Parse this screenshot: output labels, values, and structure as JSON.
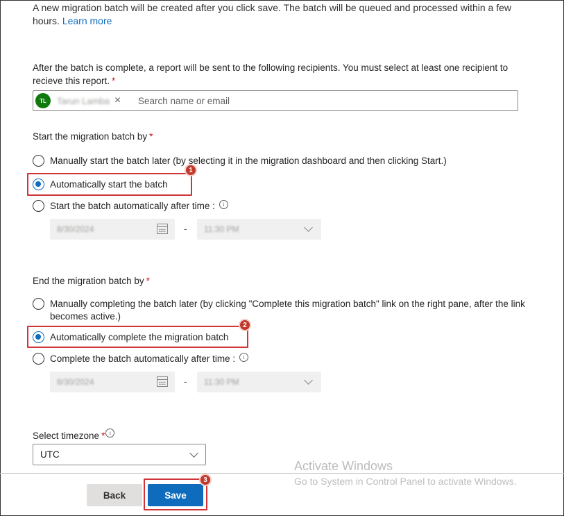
{
  "intro": {
    "text": "A new migration batch will be created after you click save. The batch will be queued and processed within a few hours.",
    "link": "Learn more"
  },
  "recipients": {
    "label": "After the batch is complete, a report will be sent to the following recipients. You must select at least one recipient to recieve this report.",
    "required_mark": "*",
    "chip_initials": "TL",
    "chip_name": "Tarun Lamba",
    "chip_remove": "×",
    "placeholder": "Search name or email"
  },
  "start": {
    "label": "Start the migration batch by",
    "required_mark": "*",
    "options": [
      "Manually start the batch later (by selecting it in the migration dashboard and then clicking Start.)",
      "Automatically start the batch",
      "Start the batch automatically after time :"
    ],
    "selected_index": 1,
    "date": "8/30/2024",
    "time": "11:30 PM",
    "separator": "-",
    "badge": "1"
  },
  "end": {
    "label": "End the migration batch by",
    "required_mark": "*",
    "options": [
      "Manually completing the batch later (by clicking \"Complete this migration batch\" link on the right pane, after the link becomes active.)",
      "Automatically complete the migration batch",
      "Complete the batch automatically after time :"
    ],
    "selected_index": 1,
    "date": "8/30/2024",
    "time": "11:30 PM",
    "separator": "-",
    "badge": "2"
  },
  "timezone": {
    "label": "Select timezone",
    "required_mark": "*",
    "value": "UTC"
  },
  "footer": {
    "back_label": "Back",
    "save_label": "Save",
    "save_badge": "3"
  },
  "watermark": {
    "title": "Activate Windows",
    "subtitle": "Go to System in Control Panel to activate Windows."
  },
  "colors": {
    "accent": "#0f6cbd",
    "highlight": "#d13438",
    "avatar": "#0e7a0d"
  },
  "icons": {
    "info": "info-icon",
    "calendar": "calendar-icon",
    "dropdown": "chevron-down-icon",
    "remove": "close-icon"
  }
}
